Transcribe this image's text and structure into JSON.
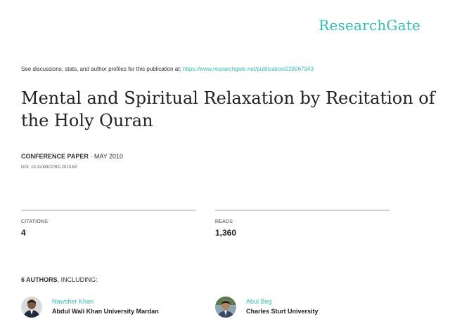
{
  "brand": "ResearchGate",
  "discussion": {
    "text": "See discussions, stats, and author profiles for this publication at:",
    "url": "https://www.researchgate.net/publication/228067943"
  },
  "title": "Mental and Spiritual Relaxation by Recitation of the Holy Quran",
  "meta": {
    "type": "CONFERENCE PAPER",
    "separator": " · ",
    "date": "MAY 2010",
    "doi": "DOI: 10.1109/ICCRD.2010.62"
  },
  "stats": {
    "citations_label": "CITATIONS",
    "citations_value": "4",
    "reads_label": "READS",
    "reads_value": "1,360"
  },
  "authors_header": {
    "count": "6 AUTHORS",
    "suffix": ", INCLUDING:"
  },
  "authors": [
    {
      "name": "Nawsher Khan",
      "institution": "Abdul Wali Khan University Mardan",
      "avatar_icon": "author-photo"
    },
    {
      "name": "Abul Beg",
      "institution": "Charles Sturt University",
      "avatar_icon": "author-photo"
    }
  ],
  "colors": {
    "accent": "#2fbfb2",
    "text": "#222222",
    "rule": "#cfcfcf"
  }
}
